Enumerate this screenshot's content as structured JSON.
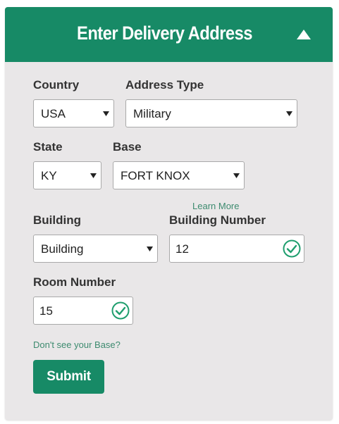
{
  "header": {
    "title": "Enter Delivery Address",
    "collapse_icon": "chevron-up-icon"
  },
  "form": {
    "country": {
      "label": "Country",
      "value": "USA"
    },
    "address_type": {
      "label": "Address Type",
      "value": "Military"
    },
    "state": {
      "label": "State",
      "value": "KY"
    },
    "base": {
      "label": "Base",
      "value": "FORT KNOX"
    },
    "learn_more": "Learn More",
    "building": {
      "label": "Building",
      "value": "Building"
    },
    "building_number": {
      "label": "Building Number",
      "value": "12",
      "valid": true
    },
    "room_number": {
      "label": "Room Number",
      "value": "15",
      "valid": true
    },
    "missing_base_link": "Don't see your Base?",
    "submit_label": "Submit"
  },
  "colors": {
    "accent": "#178a66",
    "panel_background": "#e9e7e8",
    "link": "#3d8b6f",
    "valid_check": "#1f9e6e"
  }
}
